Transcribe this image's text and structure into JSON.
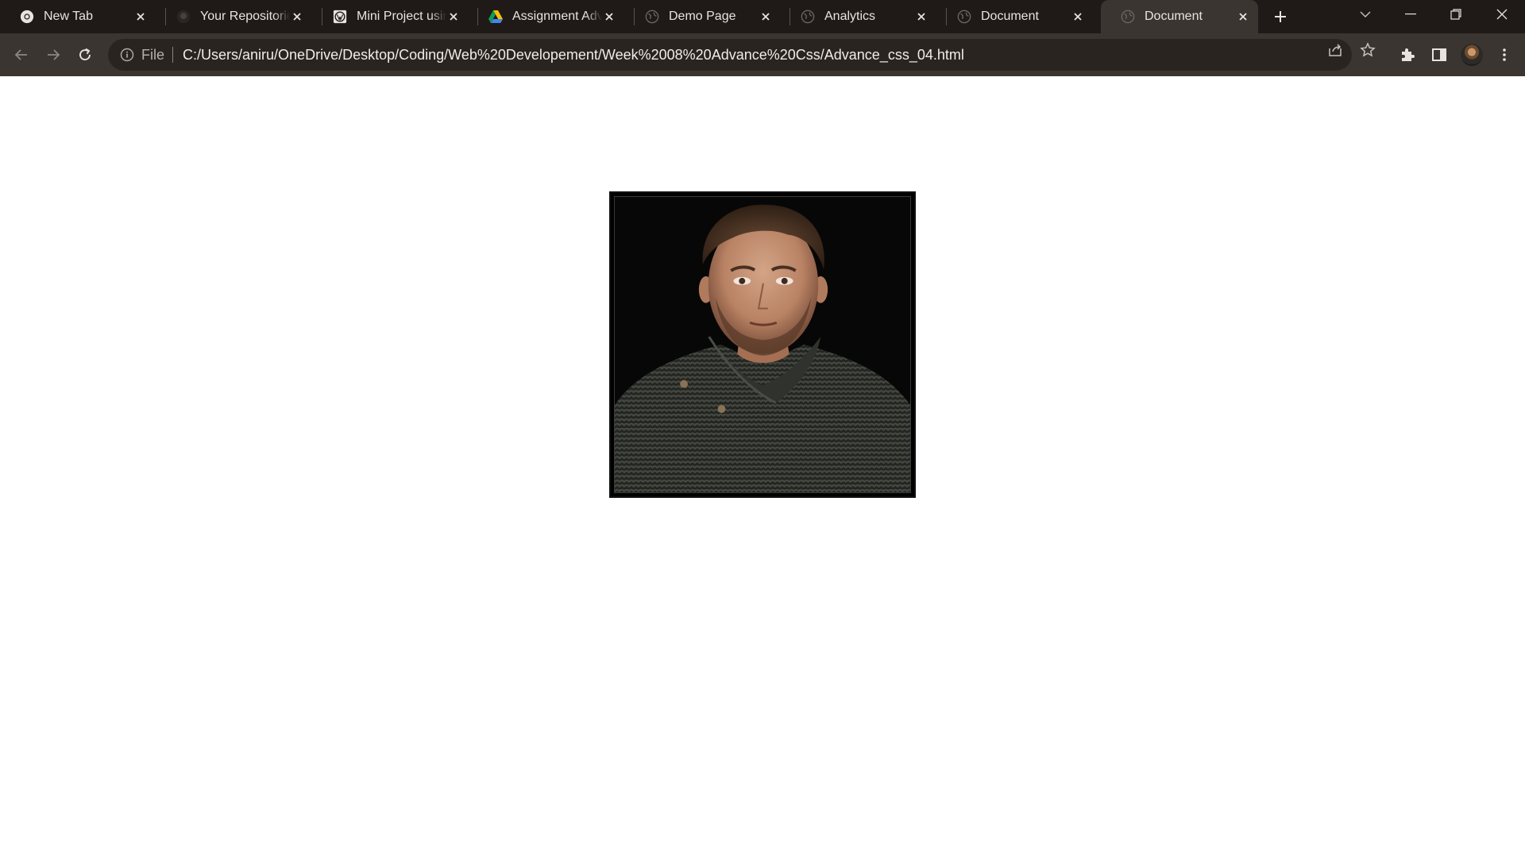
{
  "tabs": [
    {
      "title": "New Tab",
      "icon": "chrome-icon"
    },
    {
      "title": "Your Repositories",
      "icon": "github-icon"
    },
    {
      "title": "Mini Project using",
      "icon": "wordpress-icon"
    },
    {
      "title": "Assignment Advance",
      "icon": "google-drive-icon"
    },
    {
      "title": "Demo Page",
      "icon": "globe-icon"
    },
    {
      "title": "Analytics",
      "icon": "globe-icon"
    },
    {
      "title": "Document",
      "icon": "globe-icon"
    },
    {
      "title": "Document",
      "icon": "globe-icon",
      "active": true
    }
  ],
  "omnibox": {
    "scheme": "File",
    "url": "C:/Users/aniru/OneDrive/Desktop/Coding/Web%20Developement/Week%2008%20Advance%20Css/Advance_css_04.html"
  },
  "page": {
    "image": {
      "subject": "portrait photo"
    }
  },
  "colors": {
    "tabstrip_bg": "#1f1a17",
    "toolbar_bg": "#3b3531",
    "omnibox_bg": "#2a2421",
    "page_bg": "#ffffff",
    "frame_border": "#111111"
  }
}
